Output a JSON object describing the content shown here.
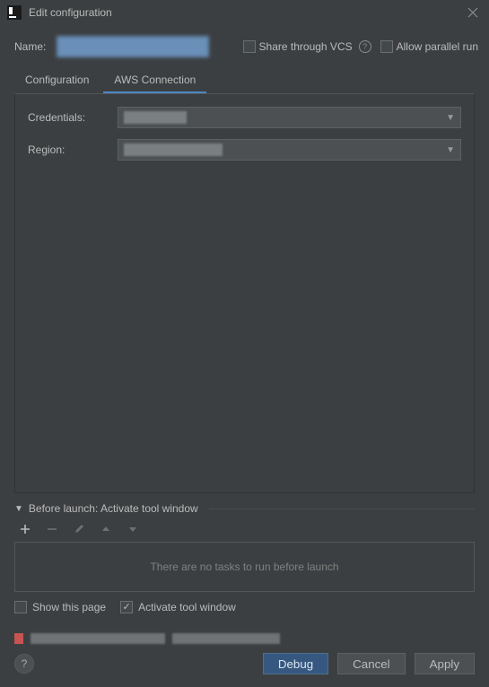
{
  "window": {
    "title": "Edit configuration"
  },
  "nameRow": {
    "label": "Name:",
    "nameValue": "",
    "shareVcsLabel": "Share through VCS",
    "allowParallelLabel": "Allow parallel run"
  },
  "tabs": {
    "configuration": "Configuration",
    "awsConnection": "AWS Connection"
  },
  "awsForm": {
    "credentialsLabel": "Credentials:",
    "regionLabel": "Region:"
  },
  "beforeLaunch": {
    "header": "Before launch: Activate tool window",
    "emptyText": "There are no tasks to run before launch",
    "showPageLabel": "Show this page",
    "activateToolLabel": "Activate tool window"
  },
  "footer": {
    "debug": "Debug",
    "cancel": "Cancel",
    "apply": "Apply"
  }
}
